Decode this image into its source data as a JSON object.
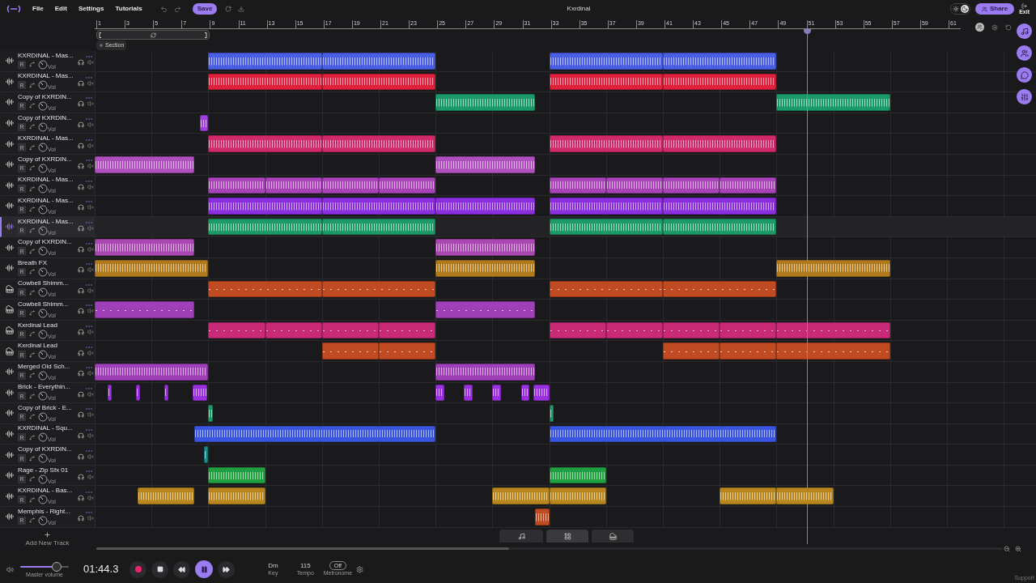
{
  "header": {
    "menu": [
      "File",
      "Edit",
      "Settings",
      "Tutorials"
    ],
    "save": "Save",
    "title": "Kxrdinal",
    "dark_mode": true,
    "share": "Share",
    "exit": "Exit"
  },
  "ruler": {
    "labels": [
      "1",
      "3",
      "5",
      "7",
      "9",
      "11",
      "13",
      "15",
      "17",
      "19",
      "21",
      "23",
      "25",
      "27",
      "29",
      "31",
      "33",
      "35",
      "37",
      "39",
      "41",
      "43",
      "45",
      "47",
      "49",
      "51",
      "53",
      "55",
      "57",
      "59",
      "61"
    ]
  },
  "section_button": "Section",
  "tracks": [
    {
      "name": "KXRDINAL - Mas...",
      "kind": "audio",
      "color": "#4a5fe6",
      "selected": false,
      "record": "R",
      "knob": "Vol"
    },
    {
      "name": "KXRDINAL - Mas...",
      "kind": "audio",
      "color": "#e0203c",
      "selected": false,
      "record": "R",
      "knob": "Vol"
    },
    {
      "name": "Copy of KXRDIN...",
      "kind": "audio",
      "color": "#1a9a6a",
      "selected": false,
      "record": "R",
      "knob": "Vol"
    },
    {
      "name": "Copy of KXRDIN...",
      "kind": "audio",
      "color": "#a040e0",
      "selected": false,
      "record": "R",
      "knob": "Vol"
    },
    {
      "name": "KXRDINAL - Mas...",
      "kind": "audio",
      "color": "#d02a6a",
      "selected": false,
      "record": "R",
      "knob": "Vol"
    },
    {
      "name": "Copy of KXRDIN...",
      "kind": "audio",
      "color": "#b050c0",
      "selected": false,
      "record": "R",
      "knob": "Vol"
    },
    {
      "name": "KXRDINAL - Mas...",
      "kind": "audio",
      "color": "#a844b8",
      "selected": false,
      "record": "R",
      "knob": "Vol"
    },
    {
      "name": "KXRDINAL - Mas...",
      "kind": "audio",
      "color": "#8a2ee0",
      "selected": false,
      "record": "R",
      "knob": "Vol"
    },
    {
      "name": "KXRDINAL - Mas...",
      "kind": "audio",
      "color": "#1e9a68",
      "selected": true,
      "record": "R",
      "knob": "Vol"
    },
    {
      "name": "Copy of KXRDIN...",
      "kind": "audio",
      "color": "#a848b0",
      "selected": false,
      "record": "R",
      "knob": "Vol"
    },
    {
      "name": "Breath FX",
      "kind": "audio",
      "color": "#b07a1c",
      "selected": false,
      "record": "R",
      "knob": "Vol"
    },
    {
      "name": "Cowbell Shimm...",
      "kind": "midi",
      "color": "#c04a22",
      "selected": false,
      "record": "R",
      "knob": "Vol"
    },
    {
      "name": "Cowbell Shimm...",
      "kind": "midi",
      "color": "#a040b8",
      "selected": false,
      "record": "R",
      "knob": "Vol"
    },
    {
      "name": "Kxrdinal Lead",
      "kind": "midi",
      "color": "#c82a78",
      "selected": false,
      "record": "R",
      "knob": "Vol"
    },
    {
      "name": "Kxrdinal Lead",
      "kind": "midi",
      "color": "#c04a22",
      "selected": false,
      "record": "R",
      "knob": "Vol"
    },
    {
      "name": "Merged Old Sch...",
      "kind": "audio",
      "color": "#a040b8",
      "selected": false,
      "record": "R",
      "knob": "Vol"
    },
    {
      "name": "Brick - Everythin...",
      "kind": "audio",
      "color": "#9a30e0",
      "selected": false,
      "record": "R",
      "knob": "Vol"
    },
    {
      "name": "Copy of Brick - E...",
      "kind": "audio",
      "color": "#1e9a68",
      "selected": false,
      "record": "R",
      "knob": "Vol"
    },
    {
      "name": "KXRDINAL - Squ...",
      "kind": "audio",
      "color": "#3a56e0",
      "selected": false,
      "record": "R",
      "knob": "Vol"
    },
    {
      "name": "Copy of KXRDIN...",
      "kind": "audio",
      "color": "#1a8a8a",
      "selected": false,
      "record": "R",
      "knob": "Vol"
    },
    {
      "name": "Rage - Zip Sfx 01",
      "kind": "audio",
      "color": "#20a040",
      "selected": false,
      "record": "R",
      "knob": "Vol"
    },
    {
      "name": "KXRDINAL - Bas...",
      "kind": "audio",
      "color": "#b8861c",
      "selected": false,
      "record": "R",
      "knob": "Vol"
    },
    {
      "name": "Memphis - Right...",
      "kind": "audio",
      "color": "#c04a22",
      "selected": false,
      "record": "R",
      "knob": "Vol"
    }
  ],
  "add_track": "Add New Track",
  "transport": {
    "volume": {
      "level": 0.75
    },
    "volume_label": "Master volume",
    "time": "01:44.3",
    "playing": true,
    "key": {
      "value": "Dm",
      "label": "Key"
    },
    "tempo": {
      "value": "115",
      "label": "Tempo"
    },
    "metronome": {
      "value": "Off",
      "label": "Metronome"
    }
  },
  "support": "Support"
}
